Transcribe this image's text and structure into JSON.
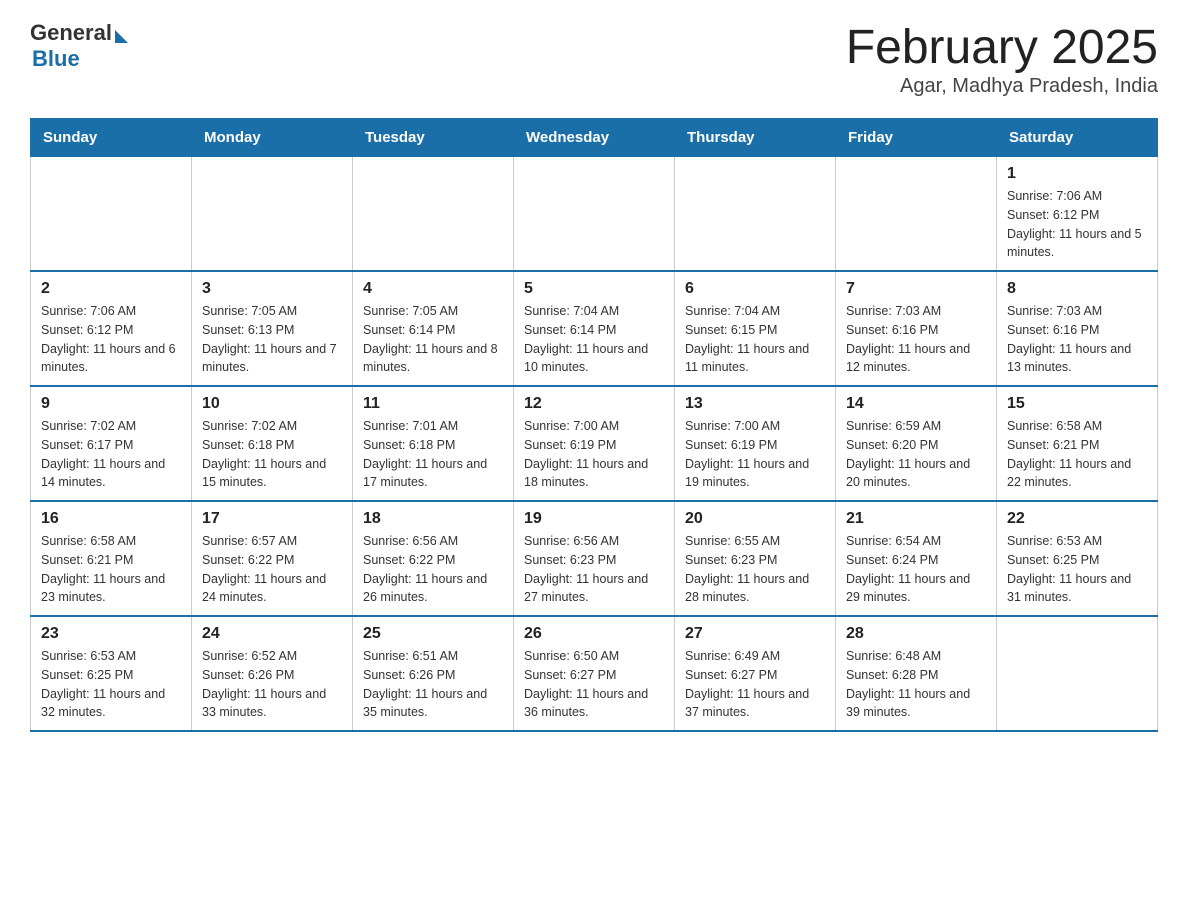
{
  "header": {
    "title": "February 2025",
    "subtitle": "Agar, Madhya Pradesh, India",
    "logo": {
      "general": "General",
      "blue": "Blue"
    }
  },
  "days_of_week": [
    "Sunday",
    "Monday",
    "Tuesday",
    "Wednesday",
    "Thursday",
    "Friday",
    "Saturday"
  ],
  "weeks": [
    [
      {
        "day": "",
        "info": ""
      },
      {
        "day": "",
        "info": ""
      },
      {
        "day": "",
        "info": ""
      },
      {
        "day": "",
        "info": ""
      },
      {
        "day": "",
        "info": ""
      },
      {
        "day": "",
        "info": ""
      },
      {
        "day": "1",
        "info": "Sunrise: 7:06 AM\nSunset: 6:12 PM\nDaylight: 11 hours and 5 minutes."
      }
    ],
    [
      {
        "day": "2",
        "info": "Sunrise: 7:06 AM\nSunset: 6:12 PM\nDaylight: 11 hours and 6 minutes."
      },
      {
        "day": "3",
        "info": "Sunrise: 7:05 AM\nSunset: 6:13 PM\nDaylight: 11 hours and 7 minutes."
      },
      {
        "day": "4",
        "info": "Sunrise: 7:05 AM\nSunset: 6:14 PM\nDaylight: 11 hours and 8 minutes."
      },
      {
        "day": "5",
        "info": "Sunrise: 7:04 AM\nSunset: 6:14 PM\nDaylight: 11 hours and 10 minutes."
      },
      {
        "day": "6",
        "info": "Sunrise: 7:04 AM\nSunset: 6:15 PM\nDaylight: 11 hours and 11 minutes."
      },
      {
        "day": "7",
        "info": "Sunrise: 7:03 AM\nSunset: 6:16 PM\nDaylight: 11 hours and 12 minutes."
      },
      {
        "day": "8",
        "info": "Sunrise: 7:03 AM\nSunset: 6:16 PM\nDaylight: 11 hours and 13 minutes."
      }
    ],
    [
      {
        "day": "9",
        "info": "Sunrise: 7:02 AM\nSunset: 6:17 PM\nDaylight: 11 hours and 14 minutes."
      },
      {
        "day": "10",
        "info": "Sunrise: 7:02 AM\nSunset: 6:18 PM\nDaylight: 11 hours and 15 minutes."
      },
      {
        "day": "11",
        "info": "Sunrise: 7:01 AM\nSunset: 6:18 PM\nDaylight: 11 hours and 17 minutes."
      },
      {
        "day": "12",
        "info": "Sunrise: 7:00 AM\nSunset: 6:19 PM\nDaylight: 11 hours and 18 minutes."
      },
      {
        "day": "13",
        "info": "Sunrise: 7:00 AM\nSunset: 6:19 PM\nDaylight: 11 hours and 19 minutes."
      },
      {
        "day": "14",
        "info": "Sunrise: 6:59 AM\nSunset: 6:20 PM\nDaylight: 11 hours and 20 minutes."
      },
      {
        "day": "15",
        "info": "Sunrise: 6:58 AM\nSunset: 6:21 PM\nDaylight: 11 hours and 22 minutes."
      }
    ],
    [
      {
        "day": "16",
        "info": "Sunrise: 6:58 AM\nSunset: 6:21 PM\nDaylight: 11 hours and 23 minutes."
      },
      {
        "day": "17",
        "info": "Sunrise: 6:57 AM\nSunset: 6:22 PM\nDaylight: 11 hours and 24 minutes."
      },
      {
        "day": "18",
        "info": "Sunrise: 6:56 AM\nSunset: 6:22 PM\nDaylight: 11 hours and 26 minutes."
      },
      {
        "day": "19",
        "info": "Sunrise: 6:56 AM\nSunset: 6:23 PM\nDaylight: 11 hours and 27 minutes."
      },
      {
        "day": "20",
        "info": "Sunrise: 6:55 AM\nSunset: 6:23 PM\nDaylight: 11 hours and 28 minutes."
      },
      {
        "day": "21",
        "info": "Sunrise: 6:54 AM\nSunset: 6:24 PM\nDaylight: 11 hours and 29 minutes."
      },
      {
        "day": "22",
        "info": "Sunrise: 6:53 AM\nSunset: 6:25 PM\nDaylight: 11 hours and 31 minutes."
      }
    ],
    [
      {
        "day": "23",
        "info": "Sunrise: 6:53 AM\nSunset: 6:25 PM\nDaylight: 11 hours and 32 minutes."
      },
      {
        "day": "24",
        "info": "Sunrise: 6:52 AM\nSunset: 6:26 PM\nDaylight: 11 hours and 33 minutes."
      },
      {
        "day": "25",
        "info": "Sunrise: 6:51 AM\nSunset: 6:26 PM\nDaylight: 11 hours and 35 minutes."
      },
      {
        "day": "26",
        "info": "Sunrise: 6:50 AM\nSunset: 6:27 PM\nDaylight: 11 hours and 36 minutes."
      },
      {
        "day": "27",
        "info": "Sunrise: 6:49 AM\nSunset: 6:27 PM\nDaylight: 11 hours and 37 minutes."
      },
      {
        "day": "28",
        "info": "Sunrise: 6:48 AM\nSunset: 6:28 PM\nDaylight: 11 hours and 39 minutes."
      },
      {
        "day": "",
        "info": ""
      }
    ]
  ]
}
